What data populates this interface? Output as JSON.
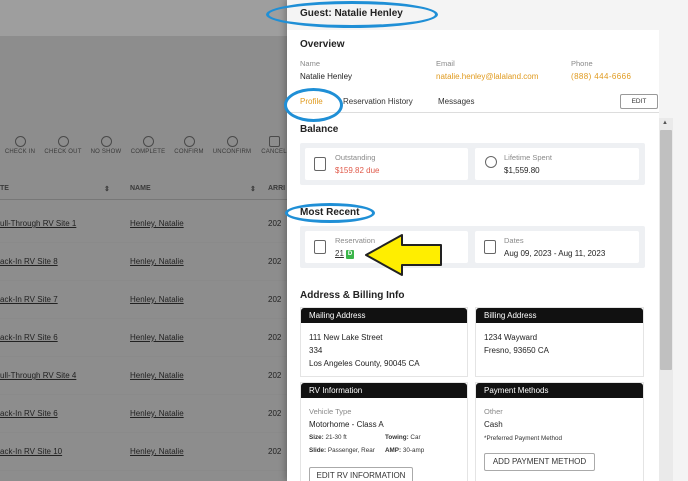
{
  "background": {
    "toolbar": [
      "CHECK IN",
      "CHECK OUT",
      "NO SHOW",
      "COMPLETE",
      "CONFIRM",
      "UNCONFIRM",
      "CANCEL"
    ],
    "columns": [
      "TE",
      "NAME",
      "ARRI"
    ],
    "rows": [
      {
        "site": "ull-Through RV Site 1",
        "name": "Henley, Natalie",
        "year": "202"
      },
      {
        "site": "ack-In RV Site 8",
        "name": "Henley, Natalie",
        "year": "202"
      },
      {
        "site": "ack-In RV Site 7",
        "name": "Henley, Natalie",
        "year": "202"
      },
      {
        "site": "ack-In RV Site 6",
        "name": "Henley, Natalie",
        "year": "202"
      },
      {
        "site": "ull-Through RV Site 4",
        "name": "Henley, Natalie",
        "year": "202"
      },
      {
        "site": "ack-In RV Site 6",
        "name": "Henley, Natalie",
        "year": "202"
      },
      {
        "site": "ack-In RV Site 10",
        "name": "Henley, Natalie",
        "year": "202"
      }
    ]
  },
  "drawer": {
    "title": "Guest: Natalie Henley",
    "overview": {
      "heading": "Overview",
      "name_label": "Name",
      "name": "Natalie Henley",
      "email_label": "Email",
      "email": "natalie.henley@lalaland.com",
      "phone_label": "Phone",
      "phone": "(888) 444-6666"
    },
    "tabs": [
      "Profile",
      "Reservation History",
      "Messages"
    ],
    "edit_label": "EDIT",
    "balance": {
      "heading": "Balance",
      "outstanding_label": "Outstanding",
      "outstanding": "$159.82 due",
      "lifetime_label": "Lifetime Spent",
      "lifetime": "$1,559.80"
    },
    "most_recent": {
      "heading": "Most Recent",
      "reservation_label": "Reservation",
      "reservation_id": "21",
      "badge": "D",
      "dates_label": "Dates",
      "dates": "Aug 09, 2023 - Aug 11, 2023"
    },
    "address": {
      "heading": "Address & Billing Info",
      "mailing_title": "Mailing Address",
      "mailing": [
        "111 New Lake Street",
        "334",
        "Los Angeles County, 90045 CA"
      ],
      "billing_title": "Billing Address",
      "billing": [
        "1234 Wayward",
        "Fresno, 93650 CA"
      ]
    },
    "rv": {
      "title": "RV Information",
      "type_label": "Vehicle Type",
      "type": "Motorhome - Class A",
      "size_label": "Size:",
      "size": "21-30 ft",
      "towing_label": "Towing:",
      "towing": "Car",
      "slide_label": "Slide:",
      "slide": "Passenger, Rear",
      "amp_label": "AMP:",
      "amp": "30-amp",
      "edit_button": "EDIT RV INFORMATION"
    },
    "payment": {
      "title": "Payment Methods",
      "other_label": "Other",
      "method": "Cash",
      "note": "*Preferred Payment Method",
      "add_button": "ADD PAYMENT METHOD"
    }
  },
  "colors": {
    "accent": "#e09a1e",
    "due": "#e05a4a",
    "badge": "#3bb54a",
    "annotation": "#1f8fd6",
    "arrow": "#ffee00"
  }
}
